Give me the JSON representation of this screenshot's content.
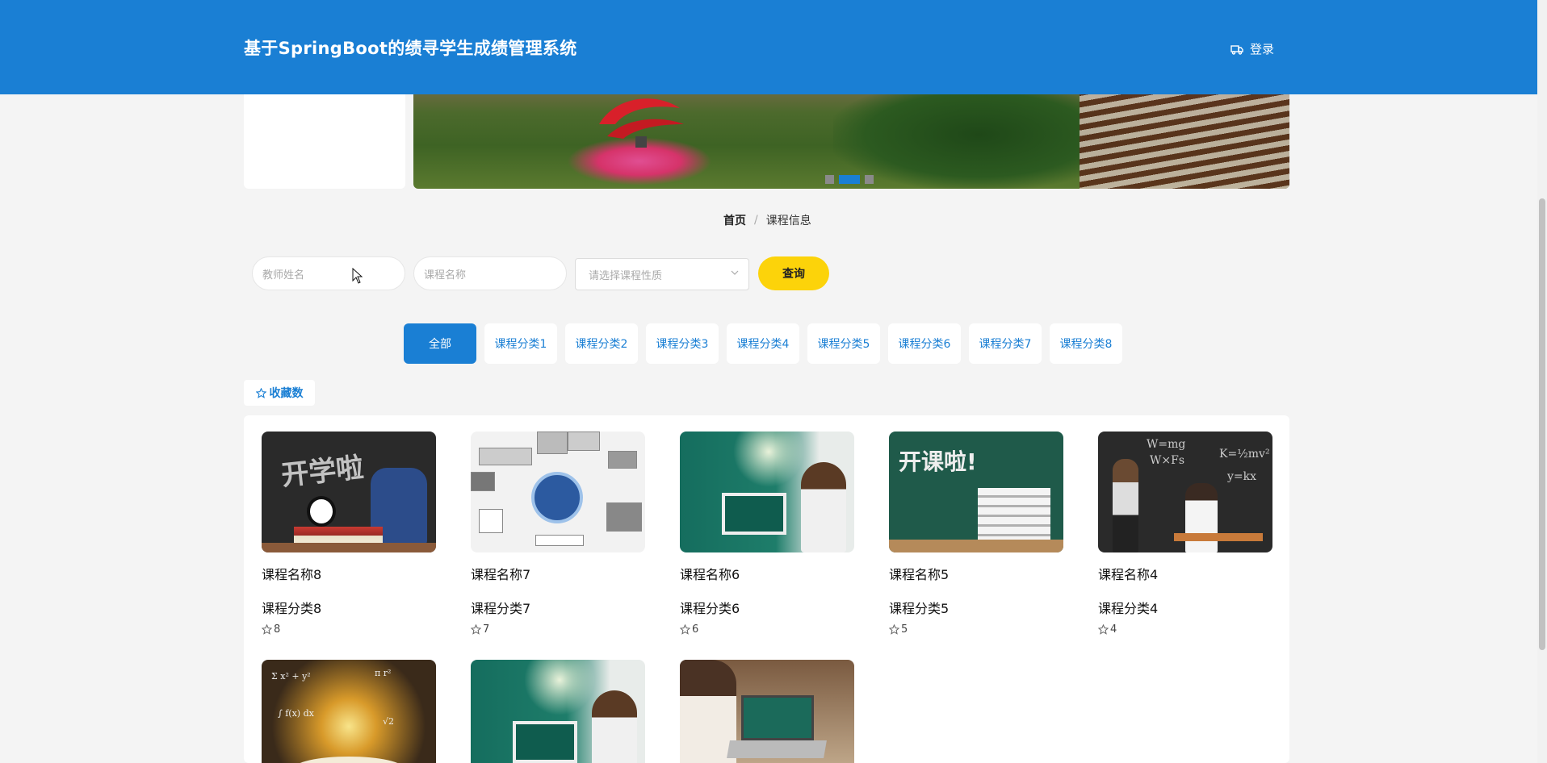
{
  "header": {
    "title": "基于SpringBoot的绩寻学生成绩管理系统",
    "login_label": "登录"
  },
  "breadcrumb": {
    "home": "首页",
    "separator": "/",
    "current": "课程信息"
  },
  "search": {
    "teacher_placeholder": "教师姓名",
    "course_placeholder": "课程名称",
    "type_placeholder": "请选择课程性质",
    "query_label": "查询"
  },
  "tabs": [
    {
      "label": "全部",
      "active": true
    },
    {
      "label": "课程分类1",
      "active": false
    },
    {
      "label": "课程分类2",
      "active": false
    },
    {
      "label": "课程分类3",
      "active": false
    },
    {
      "label": "课程分类4",
      "active": false
    },
    {
      "label": "课程分类5",
      "active": false
    },
    {
      "label": "课程分类6",
      "active": false
    },
    {
      "label": "课程分类7",
      "active": false
    },
    {
      "label": "课程分类8",
      "active": false
    }
  ],
  "sort": {
    "label": "收藏数"
  },
  "courses": [
    {
      "name": "课程名称8",
      "category": "课程分类8",
      "favorites": "8",
      "thumb": "chalkboard-backpack"
    },
    {
      "name": "课程名称7",
      "category": "课程分类7",
      "favorites": "7",
      "thumb": "mind-map"
    },
    {
      "name": "课程名称6",
      "category": "课程分类6",
      "favorites": "6",
      "thumb": "teacher-at-board"
    },
    {
      "name": "课程名称5",
      "category": "课程分类5",
      "favorites": "5",
      "thumb": "open-class-books"
    },
    {
      "name": "课程名称4",
      "category": "课程分类4",
      "favorites": "4",
      "thumb": "kids-chalkboard"
    },
    {
      "name": "",
      "category": "",
      "favorites": "",
      "thumb": "glowing-book"
    },
    {
      "name": "",
      "category": "",
      "favorites": "",
      "thumb": "teacher-at-board"
    },
    {
      "name": "",
      "category": "",
      "favorites": "",
      "thumb": "laptop-class"
    }
  ],
  "thumb_text": {
    "chalk_word": "开学啦",
    "open_word": "开课啦!"
  },
  "banner": {
    "slide_count": 3,
    "active_slide": 2
  },
  "colors": {
    "primary": "#1a7fd4",
    "query_button": "#fcd30a",
    "background": "#f4f4f4"
  }
}
